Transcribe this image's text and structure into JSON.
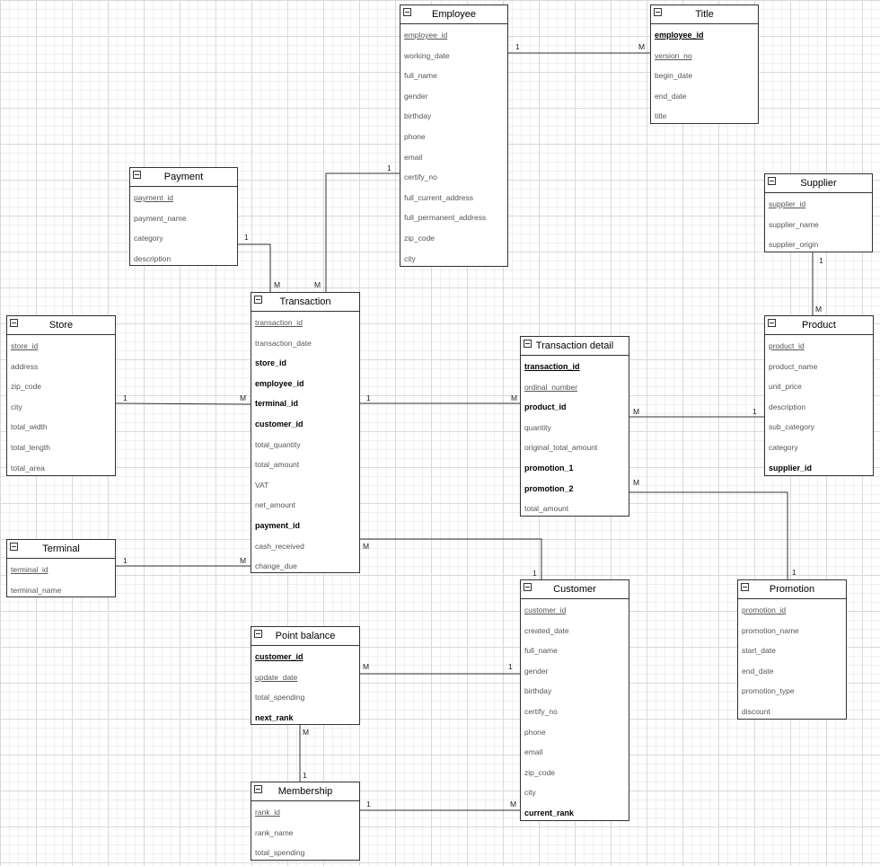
{
  "entities": [
    {
      "id": "employee",
      "title": "Employee",
      "attributes": [
        {
          "name": "employee_id",
          "style": "pk"
        },
        {
          "name": "working_date",
          "style": ""
        },
        {
          "name": "full_name",
          "style": ""
        },
        {
          "name": "gender",
          "style": ""
        },
        {
          "name": "birthday",
          "style": ""
        },
        {
          "name": "phone",
          "style": ""
        },
        {
          "name": "email",
          "style": ""
        },
        {
          "name": "certify_no",
          "style": ""
        },
        {
          "name": "full_current_address",
          "style": ""
        },
        {
          "name": "full_permanent_address",
          "style": ""
        },
        {
          "name": "zip_code",
          "style": ""
        },
        {
          "name": "city",
          "style": ""
        }
      ]
    },
    {
      "id": "title",
      "title": "Title",
      "attributes": [
        {
          "name": "employee_id",
          "style": "key pk"
        },
        {
          "name": "version_no",
          "style": "pk"
        },
        {
          "name": "begin_date",
          "style": ""
        },
        {
          "name": "end_date",
          "style": ""
        },
        {
          "name": "title",
          "style": ""
        }
      ]
    },
    {
      "id": "payment",
      "title": "Payment",
      "attributes": [
        {
          "name": "payment_id",
          "style": "pk"
        },
        {
          "name": "payment_name",
          "style": ""
        },
        {
          "name": "category",
          "style": ""
        },
        {
          "name": "description",
          "style": ""
        }
      ]
    },
    {
      "id": "supplier",
      "title": "Supplier",
      "attributes": [
        {
          "name": "supplier_id",
          "style": "pk"
        },
        {
          "name": "supplier_name",
          "style": ""
        },
        {
          "name": "supplier_origin",
          "style": ""
        }
      ]
    },
    {
      "id": "store",
      "title": "Store",
      "attributes": [
        {
          "name": "store_id",
          "style": "pk"
        },
        {
          "name": "address",
          "style": ""
        },
        {
          "name": "zip_code",
          "style": ""
        },
        {
          "name": "city",
          "style": ""
        },
        {
          "name": "total_width",
          "style": ""
        },
        {
          "name": "total_length",
          "style": ""
        },
        {
          "name": "total_area",
          "style": ""
        }
      ]
    },
    {
      "id": "transaction",
      "title": "Transaction",
      "attributes": [
        {
          "name": "transaction_id",
          "style": "pk"
        },
        {
          "name": "transaction_date",
          "style": ""
        },
        {
          "name": "store_id",
          "style": "key"
        },
        {
          "name": "employee_id",
          "style": "key"
        },
        {
          "name": "terminal_id",
          "style": "key"
        },
        {
          "name": "customer_id",
          "style": "key"
        },
        {
          "name": "total_quantity",
          "style": ""
        },
        {
          "name": "total_amount",
          "style": ""
        },
        {
          "name": "VAT",
          "style": ""
        },
        {
          "name": "net_amount",
          "style": ""
        },
        {
          "name": "payment_id",
          "style": "key"
        },
        {
          "name": "cash_received",
          "style": ""
        },
        {
          "name": "change_due",
          "style": ""
        }
      ]
    },
    {
      "id": "transaction_detail",
      "title": "Transaction detail",
      "attributes": [
        {
          "name": "transaction_id",
          "style": "key pk"
        },
        {
          "name": "ordinal_number",
          "style": "pk"
        },
        {
          "name": "product_id",
          "style": "key"
        },
        {
          "name": "quantity",
          "style": ""
        },
        {
          "name": "original_total_amount",
          "style": ""
        },
        {
          "name": "promotion_1",
          "style": "key"
        },
        {
          "name": "promotion_2",
          "style": "key"
        },
        {
          "name": "total_amount",
          "style": ""
        }
      ]
    },
    {
      "id": "product",
      "title": "Product",
      "attributes": [
        {
          "name": "product_id",
          "style": "pk"
        },
        {
          "name": "product_name",
          "style": ""
        },
        {
          "name": "unit_price",
          "style": ""
        },
        {
          "name": "description",
          "style": ""
        },
        {
          "name": "sub_category",
          "style": ""
        },
        {
          "name": "category",
          "style": ""
        },
        {
          "name": "supplier_id",
          "style": "key"
        }
      ]
    },
    {
      "id": "terminal",
      "title": "Terminal",
      "attributes": [
        {
          "name": "terminal_id",
          "style": "pk"
        },
        {
          "name": "terminal_name",
          "style": ""
        }
      ]
    },
    {
      "id": "customer",
      "title": "Customer",
      "attributes": [
        {
          "name": "customer_id",
          "style": "pk"
        },
        {
          "name": "created_date",
          "style": ""
        },
        {
          "name": "full_name",
          "style": ""
        },
        {
          "name": "gender",
          "style": ""
        },
        {
          "name": "birthday",
          "style": ""
        },
        {
          "name": "certify_no",
          "style": ""
        },
        {
          "name": "phone",
          "style": ""
        },
        {
          "name": "email",
          "style": ""
        },
        {
          "name": "zip_code",
          "style": ""
        },
        {
          "name": "city",
          "style": ""
        },
        {
          "name": "current_rank",
          "style": "key"
        }
      ]
    },
    {
      "id": "promotion",
      "title": "Promotion",
      "attributes": [
        {
          "name": "promotion_id",
          "style": "pk"
        },
        {
          "name": "promotion_name",
          "style": ""
        },
        {
          "name": "start_date",
          "style": ""
        },
        {
          "name": "end_date",
          "style": ""
        },
        {
          "name": "promotion_type",
          "style": ""
        },
        {
          "name": "discount",
          "style": ""
        }
      ]
    },
    {
      "id": "point_balance",
      "title": "Point balance",
      "attributes": [
        {
          "name": "customer_id",
          "style": "key pk"
        },
        {
          "name": "update_date",
          "style": "pk"
        },
        {
          "name": "total_spending",
          "style": ""
        },
        {
          "name": "next_rank",
          "style": "key"
        }
      ]
    },
    {
      "id": "membership",
      "title": "Membership",
      "attributes": [
        {
          "name": "rank_id",
          "style": "pk"
        },
        {
          "name": "rank_name",
          "style": ""
        },
        {
          "name": "total_spending",
          "style": ""
        }
      ]
    }
  ],
  "relationships": [
    {
      "id": "employee-title",
      "from": "employee",
      "to": "title",
      "from_card": "1",
      "to_card": "M"
    },
    {
      "id": "employee-transaction",
      "from": "employee",
      "to": "transaction",
      "from_card": "1",
      "to_card": "M"
    },
    {
      "id": "payment-transaction",
      "from": "payment",
      "to": "transaction",
      "from_card": "1",
      "to_card": "M"
    },
    {
      "id": "supplier-product",
      "from": "supplier",
      "to": "product",
      "from_card": "1",
      "to_card": "M"
    },
    {
      "id": "store-transaction",
      "from": "store",
      "to": "transaction",
      "from_card": "1",
      "to_card": "M"
    },
    {
      "id": "transaction-detail",
      "from": "transaction",
      "to": "transaction_detail",
      "from_card": "1",
      "to_card": "M"
    },
    {
      "id": "product-detail",
      "from": "product",
      "to": "transaction_detail",
      "from_card": "1",
      "to_card": "M"
    },
    {
      "id": "promotion-detail",
      "from": "promotion",
      "to": "transaction_detail",
      "from_card": "1",
      "to_card": "M"
    },
    {
      "id": "terminal-transaction",
      "from": "terminal",
      "to": "transaction",
      "from_card": "1",
      "to_card": "M"
    },
    {
      "id": "customer-transaction",
      "from": "customer",
      "to": "transaction",
      "from_card": "1",
      "to_card": "M"
    },
    {
      "id": "customer-point_balance",
      "from": "customer",
      "to": "point_balance",
      "from_card": "1",
      "to_card": "M"
    },
    {
      "id": "membership-point_balance",
      "from": "membership",
      "to": "point_balance",
      "from_card": "1",
      "to_card": "M"
    },
    {
      "id": "membership-customer",
      "from": "membership",
      "to": "customer",
      "from_card": "1",
      "to_card": "M"
    }
  ]
}
